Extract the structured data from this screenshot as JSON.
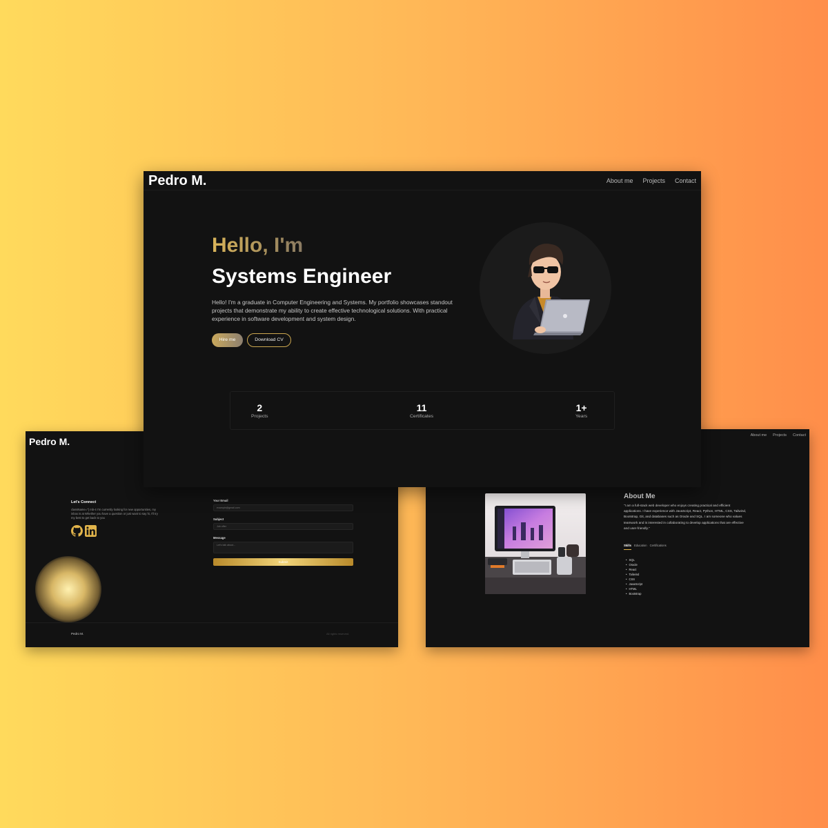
{
  "contact_window": {
    "brand": "Pedro M.",
    "lets_connect_title": "Let's Connect",
    "lets_connect_text": "className=\"{ mb-4 I'm currently looking for new opportunities, my inbox is at Whether you have a question or just want to say hi, I'll try my best to get back to you",
    "social": [
      "github-icon",
      "linkedin-icon"
    ],
    "form": {
      "email_label": "Your Email",
      "email_value": "example@gmail.com",
      "subject_label": "Subject",
      "subject_value": "Job offer",
      "message_label": "Message",
      "message_placeholder": "Let's talk about...",
      "submit_label": "Submit"
    },
    "footer_brand": "Pedro M.",
    "footer_rights": "All rights reserved."
  },
  "about_window": {
    "nav": [
      "About me",
      "Projects",
      "Contact"
    ],
    "title": "About Me",
    "text": "\"I am a full-stack web developer who enjoys creating practical and efficient applications. I have experience with JavaScript, React, Python, HTML, CSS, Tailwind, Bootstrap, Git, and databases such as Oracle and SQL. I am someone who values teamwork and is interested in collaborating to develop applications that are effective and user-friendly.\"",
    "tabs": [
      "Skills",
      "Education",
      "Certifications"
    ],
    "active_tab": "Skills",
    "skills": [
      "SQL",
      "Oracle",
      "React",
      "Tailwind",
      "CSS",
      "JavaScript",
      "HTML",
      "Bootstrap"
    ]
  },
  "main_window": {
    "brand": "Pedro M.",
    "nav": [
      "About me",
      "Projects",
      "Contact"
    ],
    "hello": "Hello, I'm",
    "role": "Systems Engineer",
    "intro": "Hello! I'm a graduate in Computer Engineering and Systems. My portfolio showcases standout projects that demonstrate my ability to create effective technological solutions. With practical experience in software development and system design.",
    "hire_button": "Hire me",
    "cv_button": "Download CV",
    "stats": [
      {
        "value": "2",
        "label": "Projects"
      },
      {
        "value": "11",
        "label": "Certificates"
      },
      {
        "value": "1+",
        "label": "Years"
      }
    ]
  },
  "colors": {
    "accent_gold": "#e1b44b",
    "window_bg": "#121212",
    "page_gradient_start": "#ffda5c",
    "page_gradient_end": "#ff8e4a"
  }
}
